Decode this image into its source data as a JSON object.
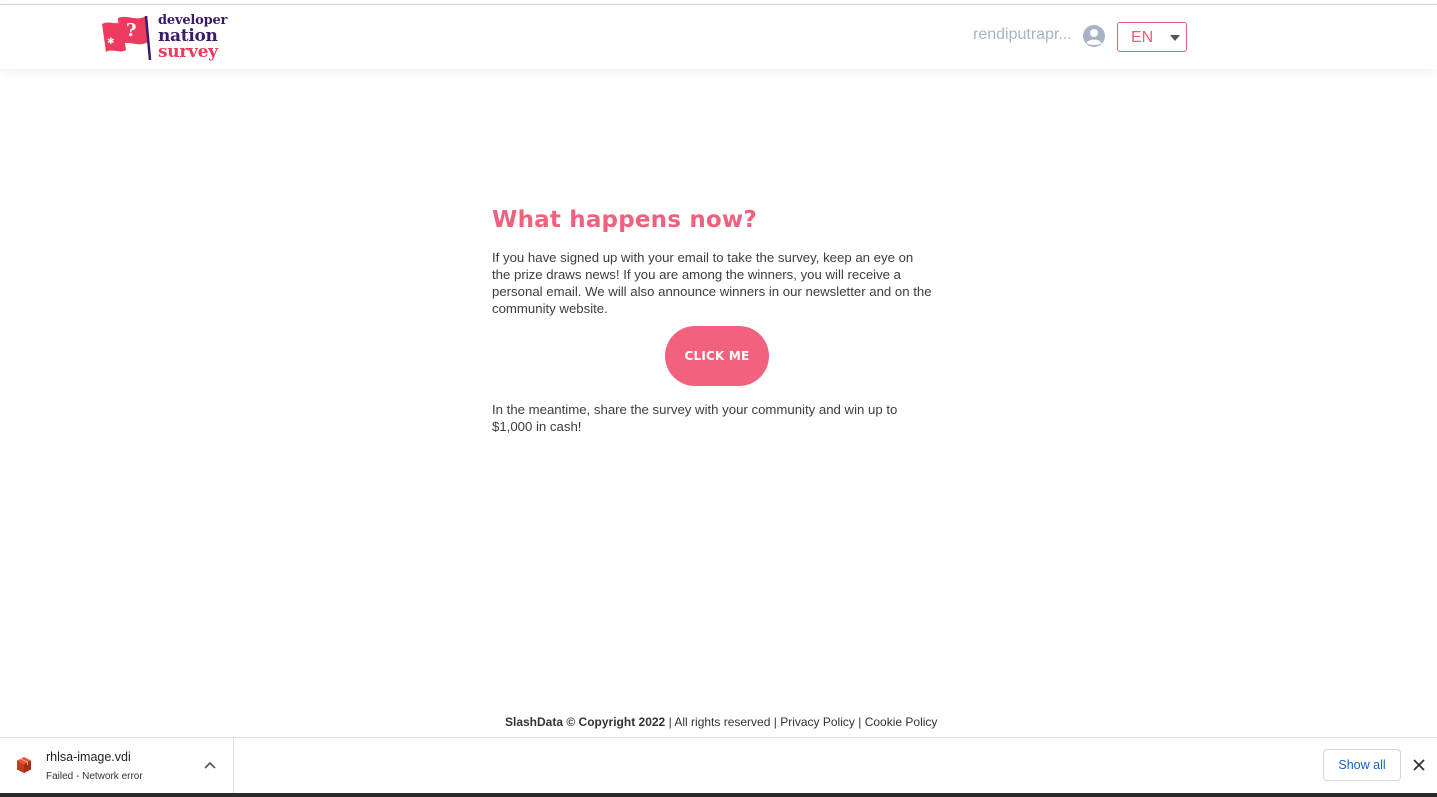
{
  "header": {
    "logo": {
      "line1": "developer",
      "line2": "nation",
      "line3": "survey"
    },
    "username": "rendiputrapr...",
    "language": "EN"
  },
  "main": {
    "title": "What happens now?",
    "paragraph": "If you have signed up with your email to take the survey, keep an eye on the prize draws news! If you are among the winners, you will receive a personal email. We will also announce winners in our newsletter and on the community website.",
    "button_label": "CLICK ME",
    "paragraph2": "In the meantime, share the survey with your community and win up to $1,000 in cash!"
  },
  "footer": {
    "brand": "SlashData © Copyright 2022",
    "rights": "| All rights reserved |",
    "privacy": "Privacy Policy",
    "separator": "|",
    "cookie": "Cookie Policy"
  },
  "downloads": {
    "file_name": "rhlsa-image.vdi",
    "status": "Failed - Network error",
    "show_all_label": "Show all"
  },
  "colors": {
    "accent": "#f2627f",
    "logo_purple": "#3a1a6b",
    "logo_red": "#ee3a5f",
    "link_blue": "#1a5fc8"
  },
  "icons": [
    "flag-logo-icon",
    "user-circle-icon",
    "caret-down-icon",
    "package-file-icon",
    "chevron-up-icon",
    "close-icon"
  ]
}
